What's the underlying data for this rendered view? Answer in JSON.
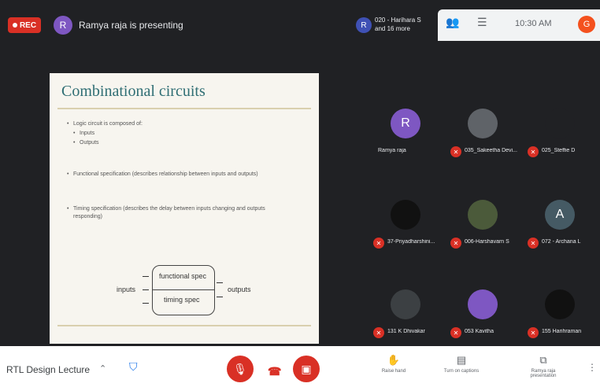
{
  "top": {
    "rec_label": "REC",
    "presenter_initial": "R",
    "presenting_text": "Ramya raja is presenting",
    "joiner_initial": "R",
    "joiner_text": "020 - Harihara S and 16 more",
    "clock": "10:30 AM",
    "user_initial": "G"
  },
  "slide": {
    "title": "Combinational circuits",
    "bullets": [
      "Logic circuit is composed of:",
      "Inputs",
      "Outputs",
      "Functional specification (describes relationship between inputs and outputs)",
      "Timing specification (describes the delay between inputs changing and outputs responding)"
    ],
    "diagram": {
      "inputs": "inputs",
      "outputs": "outputs",
      "functional": "functional spec",
      "timing": "timing spec"
    }
  },
  "participants": [
    {
      "initial": "R",
      "name": "Ramya raja",
      "color": "#7e57c2",
      "muted": false
    },
    {
      "initial": "",
      "name": "035_Sakeetha Devi...",
      "color": "#5f6368",
      "muted": true
    },
    {
      "initial": "",
      "name": "025_Steffie D",
      "color": "#202124",
      "muted": true
    },
    {
      "initial": "",
      "name": "37-Priyadharshini...",
      "color": "#111111",
      "muted": true
    },
    {
      "initial": "",
      "name": "006-Harshavarn S",
      "color": "#4b5a3a",
      "muted": true
    },
    {
      "initial": "A",
      "name": "072 - Archana L",
      "color": "#455a64",
      "muted": true
    },
    {
      "initial": "",
      "name": "131 K Dhivakar",
      "color": "#3c4043",
      "muted": true
    },
    {
      "initial": "",
      "name": "053 Kavitha",
      "color": "#7e57c2",
      "muted": true
    },
    {
      "initial": "",
      "name": "155 Harihraman",
      "color": "#111111",
      "muted": true
    }
  ],
  "bottom": {
    "meeting_name": "RTL Design Lecture",
    "actions": [
      {
        "label": "Raise hand",
        "icon": "raise-hand-icon"
      },
      {
        "label": "Turn on captions",
        "icon": "captions-icon"
      },
      {
        "label": "Ramya raja presentation",
        "icon": "present-icon"
      }
    ]
  },
  "colors": {
    "accent": "#d93025",
    "slide_title": "#2f6e74"
  }
}
